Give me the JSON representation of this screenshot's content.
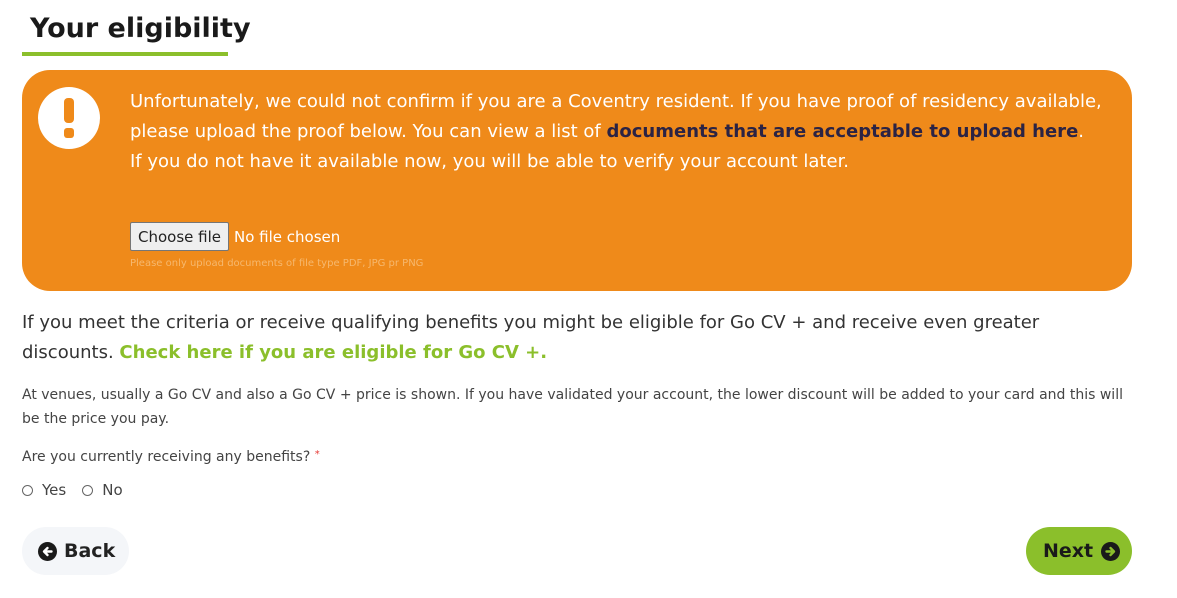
{
  "page": {
    "title": "Your eligibility"
  },
  "alert": {
    "icon": "exclamation-icon",
    "line1_before": "Unfortunately, we could not confirm if you are a Coventry resident. If you have proof of residency available, please upload the proof below. You can view a list of ",
    "line1_link": "documents that are acceptable to upload here",
    "line1_after": ".",
    "line2": "If you do not have it available now, you will be able to verify your account later.",
    "file_button": "Choose file",
    "file_status": "No file chosen",
    "file_hint": "Please only upload documents of file type PDF, JPG pr PNG"
  },
  "criteria": {
    "text": "If you meet the criteria or receive qualifying benefits you might be eligible for Go CV + and receive even greater discounts. ",
    "link": "Check here if you are eligible for Go CV +."
  },
  "venues": {
    "text": "At venues, usually a Go CV and also a Go CV + price is shown. If you have validated your account, the lower discount will be added to your card and this will be the price you pay."
  },
  "benefits_question": {
    "label": "Are you currently receiving any benefits?",
    "required_mark": "*",
    "options": [
      "Yes",
      "No"
    ]
  },
  "nav": {
    "back_label": "Back",
    "next_label": "Next"
  },
  "colors": {
    "accent_green": "#8bbf2b",
    "alert_orange": "#ef8a1a",
    "link_dark": "#2b2344"
  }
}
